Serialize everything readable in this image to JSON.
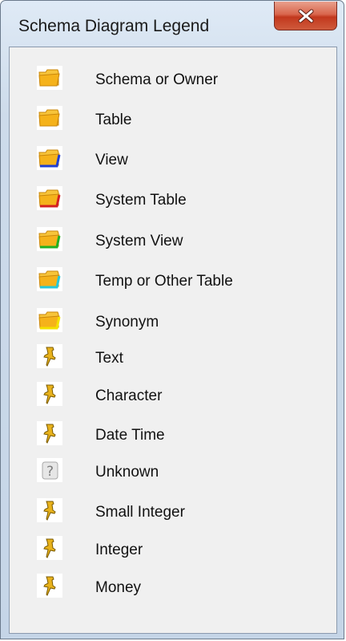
{
  "window": {
    "title": "Schema Diagram Legend"
  },
  "legend_items": [
    {
      "label": "Schema or Owner",
      "icon": "folder-icon",
      "accent": "#f2b418"
    },
    {
      "label": "Table",
      "icon": "folder-icon",
      "accent": "#f2b418"
    },
    {
      "label": "View",
      "icon": "folder-view-icon",
      "accent": "#1f3fd1"
    },
    {
      "label": "System Table",
      "icon": "folder-system-table-icon",
      "accent": "#d42020"
    },
    {
      "label": "System View",
      "icon": "folder-system-view-icon",
      "accent": "#22b022"
    },
    {
      "label": "Temp or Other Table",
      "icon": "folder-temp-icon",
      "accent": "#27c7d8"
    },
    {
      "label": "Synonym",
      "icon": "folder-synonym-icon",
      "accent": "#f3e200"
    },
    {
      "label": "Text",
      "icon": "pushpin-icon",
      "accent": "#d9a400"
    },
    {
      "label": "Character",
      "icon": "pushpin-icon",
      "accent": "#d9a400"
    },
    {
      "label": "Date Time",
      "icon": "pushpin-icon",
      "accent": "#d9a400"
    },
    {
      "label": "Unknown",
      "icon": "question-icon",
      "accent": "#9a9a9a"
    },
    {
      "label": "Small Integer",
      "icon": "pushpin-icon",
      "accent": "#d9a400"
    },
    {
      "label": "Integer",
      "icon": "pushpin-icon",
      "accent": "#d9a400"
    },
    {
      "label": "Money",
      "icon": "pushpin-icon",
      "accent": "#d9a400"
    }
  ]
}
